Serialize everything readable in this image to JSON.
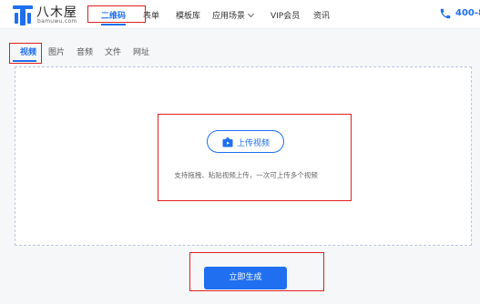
{
  "brand": {
    "name": "八木屋",
    "sub": "bamuwu.com"
  },
  "nav": {
    "items": [
      {
        "label": "二维码",
        "active": true
      },
      {
        "label": "表单",
        "active": false
      },
      {
        "label": "模板库",
        "active": false
      },
      {
        "label": "应用场景",
        "active": false,
        "dropdown": true
      },
      {
        "label": "VIP会员",
        "active": false
      },
      {
        "label": "资讯",
        "active": false
      }
    ],
    "phone": "400-8"
  },
  "tabs": [
    {
      "label": "视频",
      "active": true
    },
    {
      "label": "图片",
      "active": false
    },
    {
      "label": "音频",
      "active": false
    },
    {
      "label": "文件",
      "active": false
    },
    {
      "label": "网址",
      "active": false
    }
  ],
  "upload": {
    "button_label": "上传视频",
    "hint": "支持拖拽、粘贴视频上传，一次可上传多个视频"
  },
  "actions": {
    "generate_label": "立即生成"
  },
  "colors": {
    "accent": "#1f6ff0",
    "highlight_box": "#e02020"
  }
}
